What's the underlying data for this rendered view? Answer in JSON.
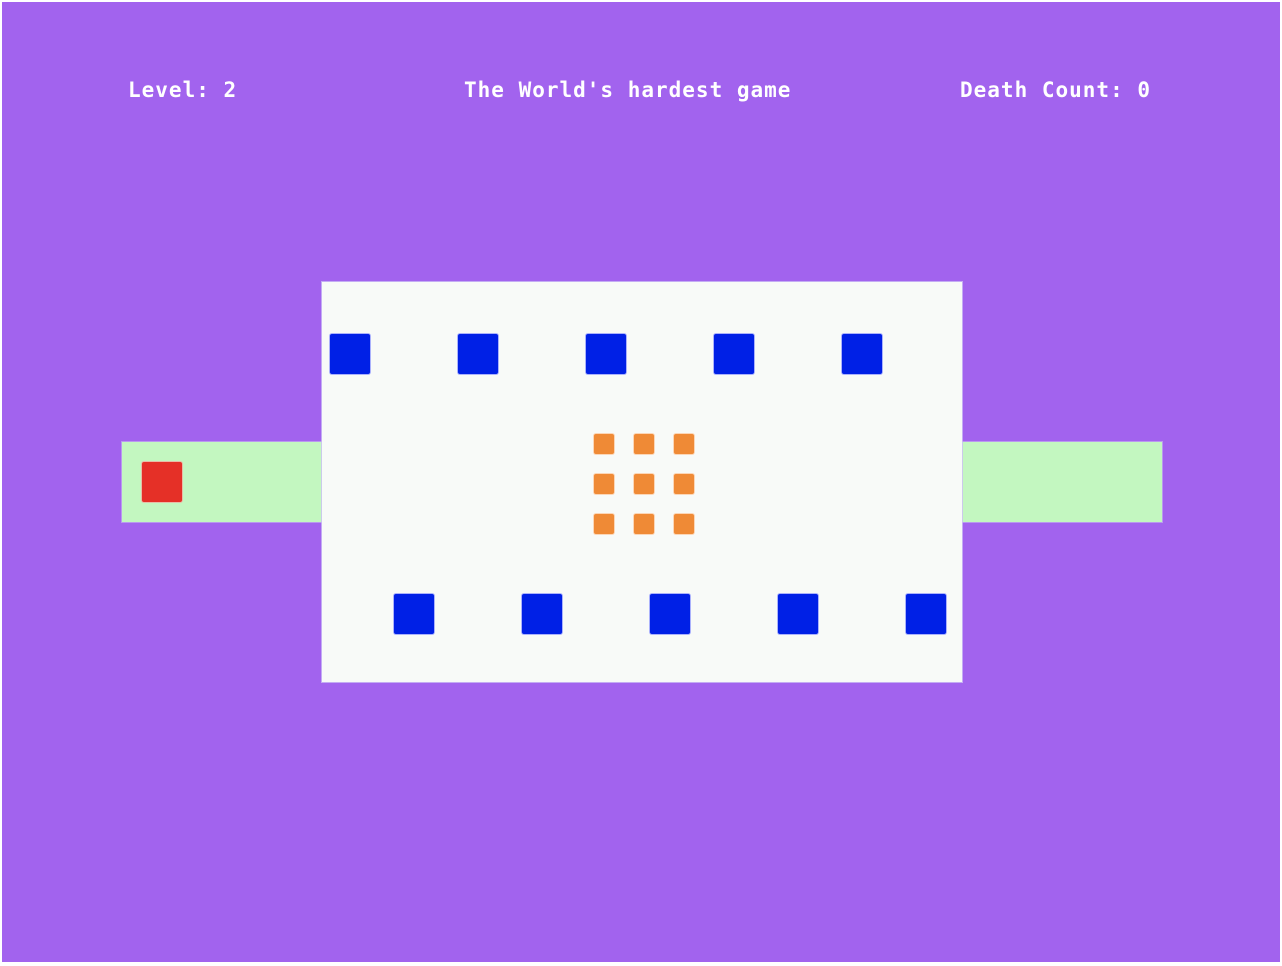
{
  "hud": {
    "level_text": "Level: 2",
    "title_text": "The World's hardest game",
    "death_text": "Death Count: 0"
  },
  "game": {
    "level": 2,
    "deaths": 0,
    "enemy_count": 10,
    "coin_count": 9,
    "colors": {
      "background": "#a263ee",
      "arena": "#f8faf8",
      "safe_zone": "#c3f7c0",
      "enemy": "#0020e6",
      "coin": "#ef8a36",
      "player": "#e53027"
    },
    "icons": {
      "player": "red-square",
      "enemy": "blue-square",
      "coin": "orange-square"
    }
  }
}
